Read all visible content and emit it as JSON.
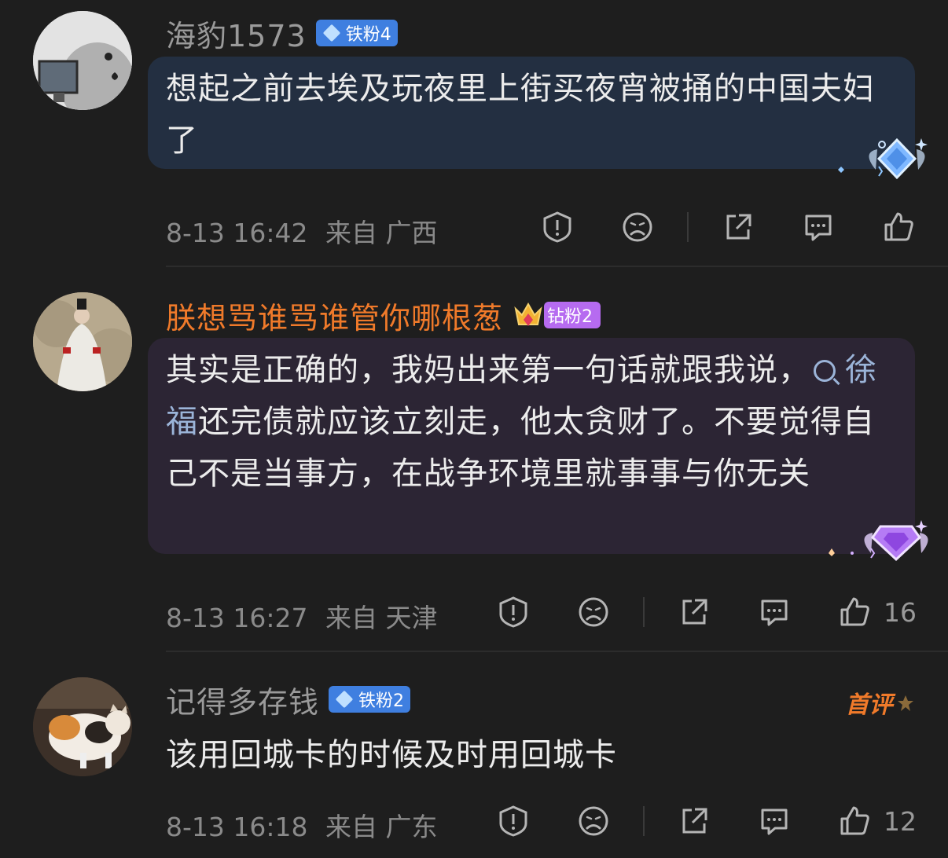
{
  "comments": [
    {
      "username": "海豹1573",
      "badge": "铁粉4",
      "text": "想起之前去埃及玩夜里上街买夜宵被捅的中国夫妇了",
      "time": "8-13 16:42",
      "location": "来自 广西",
      "likes": ""
    },
    {
      "username": "朕想骂谁骂谁管你哪根葱",
      "badge": "钻粉2",
      "text_part1": "其实是正确的，我妈出来第一句话就跟我说，",
      "search_term": "徐福",
      "text_part2": "还完债就应该立刻走，他太贪财了。不要觉得自己不是当事方，在战争环境里就事事与你无关",
      "time": "8-13 16:27",
      "location": "来自 天津",
      "likes": "16"
    },
    {
      "username": "记得多存钱",
      "badge": "铁粉2",
      "first_tag": "首评",
      "text": "该用回城卡的时候及时用回城卡",
      "time": "8-13 16:18",
      "location": "来自 广东",
      "likes": "12"
    }
  ],
  "icons": [
    "report-icon",
    "dislike-icon",
    "share-icon",
    "reply-icon",
    "like-icon",
    "search-icon"
  ],
  "colors": {
    "background": "#1e1e1e",
    "vip_name": "#f07a2a",
    "iron_badge": "#3f7fe0",
    "diamond_badge": "#b66bf0",
    "link": "#9bb4d8"
  }
}
